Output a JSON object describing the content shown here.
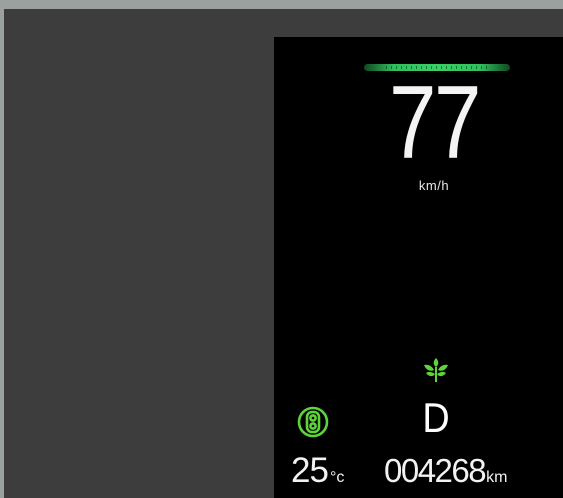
{
  "dashboard": {
    "speed": "77",
    "speed_unit": "km/h",
    "gear": "D",
    "temperature": "25",
    "temperature_unit": "°c",
    "odometer": "004268",
    "odometer_unit": "km",
    "icons": {
      "eco_bar": "eco-guide-bar",
      "leaf": "eco-leaf-icon",
      "eco_mode": "eco-mode-indicator-icon"
    },
    "colors": {
      "accent_green": "#4fd43a",
      "eco_bar_green": "#38d066",
      "text": "#f4f4f4",
      "screen_bg": "#000000"
    }
  }
}
